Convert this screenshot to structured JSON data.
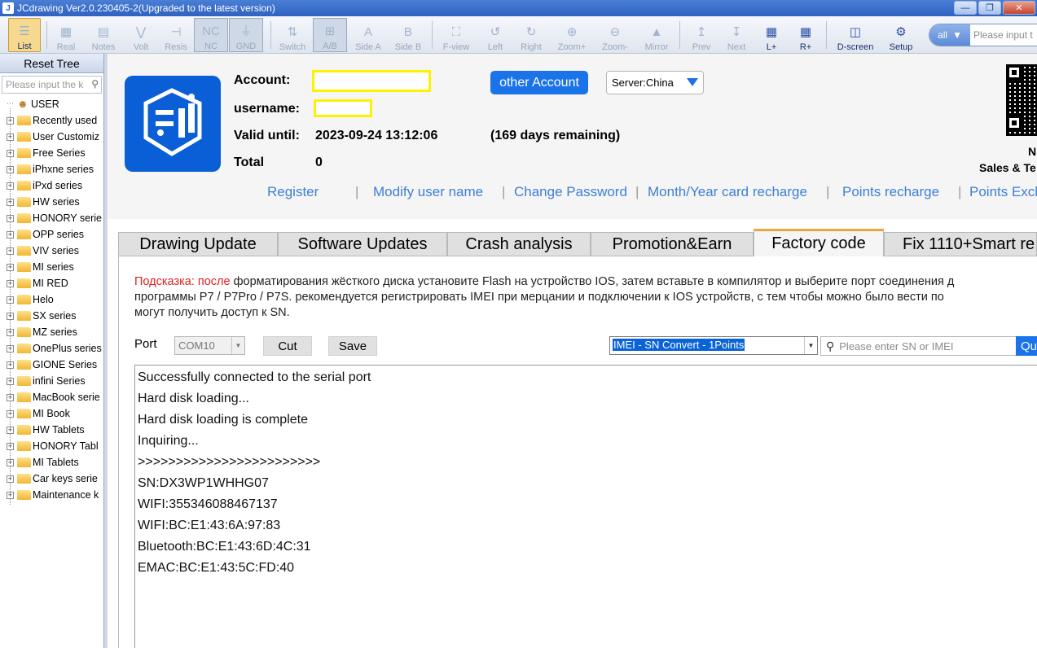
{
  "window": {
    "title": "JCdrawing Ver2.0.230405-2(Upgraded to the latest version)",
    "controls": [
      "—",
      "❐",
      "✕"
    ]
  },
  "toolbar": {
    "items": [
      {
        "label": "List",
        "icon": "list-icon"
      },
      {
        "label": "Real",
        "icon": "image-icon"
      },
      {
        "label": "Notes",
        "icon": "notes-icon"
      },
      {
        "label": "Volt",
        "icon": "volt-icon"
      },
      {
        "label": "Resis",
        "icon": "resistor-icon"
      },
      {
        "label": "NC",
        "icon_text": "NC"
      },
      {
        "label": "GND",
        "icon": "ground-icon"
      },
      {
        "label": "Switch",
        "icon": "switch-icon"
      },
      {
        "label": "A/B",
        "icon": "ab-icon"
      },
      {
        "label": "Side A",
        "icon_text": "A"
      },
      {
        "label": "Side B",
        "icon_text": "B"
      },
      {
        "label": "F-view",
        "icon": "f-view-icon"
      },
      {
        "label": "Left",
        "icon": "rotate-left-icon"
      },
      {
        "label": "Right",
        "icon": "rotate-right-icon"
      },
      {
        "label": "Zoom+",
        "icon": "zoom-in-icon"
      },
      {
        "label": "Zoom-",
        "icon": "zoom-out-icon"
      },
      {
        "label": "Mirror",
        "icon": "mirror-icon"
      },
      {
        "label": "Prev",
        "icon": "prev-icon"
      },
      {
        "label": "Next",
        "icon": "next-icon"
      },
      {
        "label": "L+",
        "icon": "l-plus-icon"
      },
      {
        "label": "R+",
        "icon": "r-plus-icon"
      },
      {
        "label": "D-screen",
        "icon": "d-screen-icon"
      },
      {
        "label": "Setup",
        "icon": "gear-icon"
      }
    ],
    "search_scope": "all",
    "search_placeholder": "Please input t"
  },
  "sidebar": {
    "reset_label": "Reset Tree",
    "search_placeholder": "Please input the k",
    "items": [
      "USER",
      "Recently used",
      "User Customiz",
      "Free Series",
      "iPhxne series",
      "iPxd series",
      "HW series",
      "HONORY serie",
      "OPP series",
      "VIV series",
      "MI series",
      "MI RED",
      "Helo",
      "SX series",
      "MZ series",
      "OnePlus series",
      "GIONE Series",
      "infini Series",
      "MacBook serie",
      "MI Book",
      "HW Tablets",
      "HONORY Tabl",
      "MI Tablets",
      "Car keys serie",
      "Maintenance k"
    ]
  },
  "account": {
    "account_label": "Account:",
    "username_label": "username:",
    "valid_label": "Valid until:",
    "valid_value": "2023-09-24 13:12:06",
    "remaining": "(169 days remaining)",
    "total_label": "Total",
    "total_value": "0",
    "other_account": "other Account",
    "server": "Server:China",
    "side_text_1": "N",
    "side_text_2": "Sales & Te",
    "links": [
      "Register",
      "Modify user name",
      "Change Password",
      "Month/Year card recharge",
      "Points recharge",
      "Points Exch"
    ],
    "link_separator": "|"
  },
  "tabs": [
    {
      "label": "Drawing Update",
      "active": false
    },
    {
      "label": "Software Updates",
      "active": false
    },
    {
      "label": "Crash analysis",
      "active": false
    },
    {
      "label": "Promotion&Earn",
      "active": false
    },
    {
      "label": "Factory code",
      "active": true
    },
    {
      "label": "Fix 1110+Smart re",
      "active": false
    }
  ],
  "factory": {
    "hint_prefix": "Подсказка: после",
    "hint_line1": " форматирования жёсткого диска установите Flash на устройство IOS, затем вставьте в компилятор и выберите порт соединения д",
    "hint_line2": "программы P7 / P7Pro / P7S. рекомендуется регистрировать IMEI при мерцании и подключении к IOS устройств, с тем чтобы можно было вести по",
    "hint_line3": "могут получить доступ к SN.",
    "port_label": "Port",
    "port_value": "COM10",
    "cut_label": "Cut",
    "save_label": "Save",
    "convert_value": "IMEI - SN Convert - 1Points",
    "sn_placeholder": "Please enter SN or IMEI",
    "query_label": "Qu",
    "log": [
      "Successfully connected to the serial port",
      "Hard disk loading...",
      "Hard disk loading is complete",
      "Inquiring...",
      ">>>>>>>>>>>>>>>>>>>>>>>>",
      "SN:DX3WP1WHHG07",
      "WIFI:355346088467137",
      "WIFI:BC:E1:43:6A:97:83",
      "Bluetooth:BC:E1:43:6D:4C:31",
      "EMAC:BC:E1:43:5C:FD:40"
    ]
  },
  "colors": {
    "accent": "#1a73e8",
    "logo_blue": "#0b5fd6",
    "highlight_box": "#fff200",
    "hint_red": "#e02020",
    "tab_active_border": "#f0a53a"
  }
}
